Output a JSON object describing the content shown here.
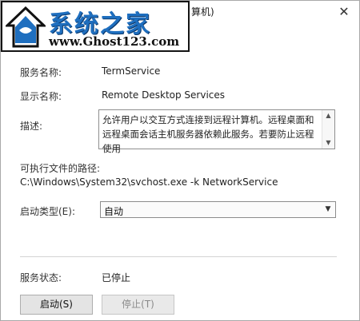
{
  "window": {
    "title_fragment": "算机)",
    "close_glyph": "✕"
  },
  "watermark": {
    "main": "系统之家",
    "url": "www.Ghost123.com"
  },
  "fields": {
    "service_name_label": "服务名称:",
    "service_name_value": "TermService",
    "display_name_label": "显示名称:",
    "display_name_value": "Remote Desktop Services",
    "description_label": "描述:",
    "description_text": "允许用户以交互方式连接到远程计算机。远程桌面和远程桌面会话主机服务器依赖此服务。若要防止远程使用",
    "path_label": "可执行文件的路径:",
    "path_value": "C:\\Windows\\System32\\svchost.exe -k NetworkService",
    "startup_type_label": "启动类型(E):",
    "startup_type_value": "自动",
    "status_label": "服务状态:",
    "status_value": "已停止"
  },
  "buttons": {
    "start": "启动(S)",
    "stop": "停止(T)"
  }
}
